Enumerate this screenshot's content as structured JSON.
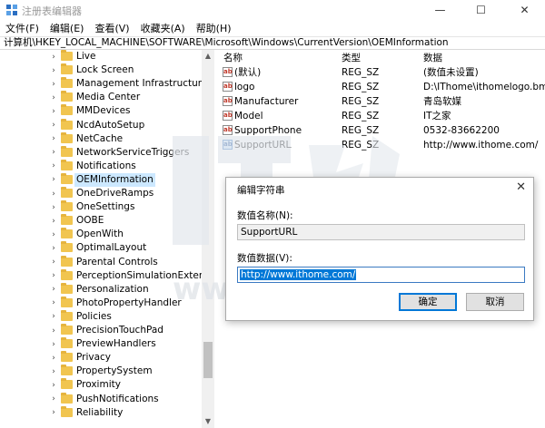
{
  "window": {
    "title": "注册表编辑器",
    "minimize": "—",
    "maximize": "☐",
    "close": "✕"
  },
  "menu": [
    "文件(F)",
    "编辑(E)",
    "查看(V)",
    "收藏夹(A)",
    "帮助(H)"
  ],
  "address": "计算机\\HKEY_LOCAL_MACHINE\\SOFTWARE\\Microsoft\\Windows\\CurrentVersion\\OEMInformation",
  "tree": {
    "items": [
      "Live",
      "Lock Screen",
      "Management Infrastructure",
      "Media Center",
      "MMDevices",
      "NcdAutoSetup",
      "NetCache",
      "NetworkServiceTriggers",
      "Notifications",
      "OEMInformation",
      "OneDriveRamps",
      "OneSettings",
      "OOBE",
      "OpenWith",
      "OptimalLayout",
      "Parental Controls",
      "PerceptionSimulationExtensions",
      "Personalization",
      "PhotoPropertyHandler",
      "Policies",
      "PrecisionTouchPad",
      "PreviewHandlers",
      "Privacy",
      "PropertySystem",
      "Proximity",
      "PushNotifications",
      "Reliability"
    ],
    "selected_index": 9,
    "chevron": "›"
  },
  "list": {
    "headers": {
      "name": "名称",
      "type": "类型",
      "data": "数据"
    },
    "icon_text": "ab",
    "rows": [
      {
        "name": "(默认)",
        "type": "REG_SZ",
        "data": "(数值未设置)"
      },
      {
        "name": "logo",
        "type": "REG_SZ",
        "data": "D:\\IThome\\ithomelogo.bmp"
      },
      {
        "name": "Manufacturer",
        "type": "REG_SZ",
        "data": "青岛软媒"
      },
      {
        "name": "Model",
        "type": "REG_SZ",
        "data": "IT之家"
      },
      {
        "name": "SupportPhone",
        "type": "REG_SZ",
        "data": "0532-83662200"
      },
      {
        "name": "SupportURL",
        "type": "REG_SZ",
        "data": "http://www.ithome.com/"
      }
    ],
    "selected_index": 5
  },
  "dialog": {
    "title": "编辑字符串",
    "close": "✕",
    "name_label": "数值名称(N):",
    "name_value": "SupportURL",
    "data_label": "数值数据(V):",
    "data_value": "http://www.ithome.com/",
    "ok": "确定",
    "cancel": "取消"
  },
  "watermark": {
    "text": "www.ithome.com",
    "color": "#dfe3e8"
  },
  "colors": {
    "selection": "#cce8ff",
    "accent": "#0078d7",
    "folder": "#f1c550"
  }
}
